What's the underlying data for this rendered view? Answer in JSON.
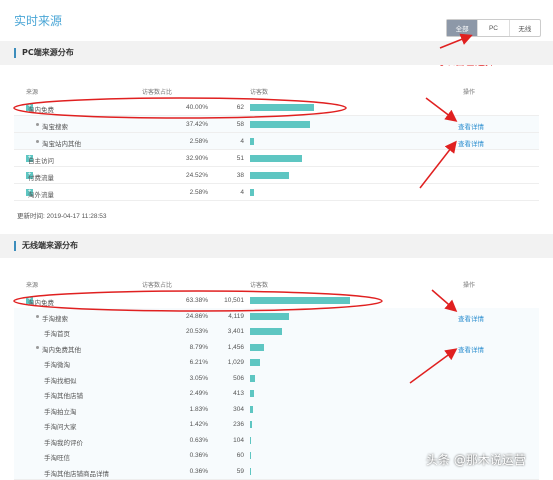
{
  "header": {
    "title": "实时来源"
  },
  "segment": {
    "options": [
      "全部",
      "PC",
      "无线"
    ],
    "selected": "全部"
  },
  "annotation": {
    "note": "可以自己选择!"
  },
  "pc": {
    "title": "PC端来源分布",
    "columns": {
      "source": "来源",
      "share": "访客数占比",
      "visitors": "访客数",
      "action": "操作"
    },
    "rows": [
      {
        "name": "淘内免费",
        "share": "40.00%",
        "count": "62",
        "bar": 1.0,
        "expand": true,
        "op": ""
      },
      {
        "name": "淘宝搜索",
        "share": "37.42%",
        "count": "58",
        "bar": 0.935,
        "sub": true,
        "op": "查看详情"
      },
      {
        "name": "淘宝站内其他",
        "share": "2.58%",
        "count": "4",
        "bar": 0.065,
        "sub": true,
        "op": "查看详情"
      },
      {
        "name": "自主访问",
        "share": "32.90%",
        "count": "51",
        "bar": 0.82,
        "expand": true,
        "op": ""
      },
      {
        "name": "付费流量",
        "share": "24.52%",
        "count": "38",
        "bar": 0.61,
        "expand": true,
        "op": ""
      },
      {
        "name": "淘外流量",
        "share": "2.58%",
        "count": "4",
        "bar": 0.065,
        "expand": true,
        "op": ""
      }
    ],
    "updated": "更新时间: 2019-04-17 11:28:53"
  },
  "mobile": {
    "title": "无线端来源分布",
    "columns": {
      "source": "来源",
      "share": "访客数占比",
      "visitors": "访客数",
      "action": "操作"
    },
    "rows": [
      {
        "name": "淘内免费",
        "share": "63.38%",
        "count": "10,501",
        "bar": 1.0,
        "expand": true,
        "op": ""
      },
      {
        "name": "手淘搜索",
        "share": "24.86%",
        "count": "4,119",
        "bar": 0.392,
        "sub": true,
        "op": "查看详情"
      },
      {
        "name": "手淘首页",
        "share": "20.53%",
        "count": "3,401",
        "bar": 0.324,
        "sub2": true,
        "op": ""
      },
      {
        "name": "淘内免费其他",
        "share": "8.79%",
        "count": "1,456",
        "bar": 0.139,
        "sub": true,
        "op": "查看详情"
      },
      {
        "name": "手淘微淘",
        "share": "6.21%",
        "count": "1,029",
        "bar": 0.098,
        "sub2": true,
        "op": ""
      },
      {
        "name": "手淘找相似",
        "share": "3.05%",
        "count": "506",
        "bar": 0.048,
        "sub2": true,
        "op": ""
      },
      {
        "name": "手淘其他店铺",
        "share": "2.49%",
        "count": "413",
        "bar": 0.039,
        "sub2": true,
        "op": ""
      },
      {
        "name": "手淘拍立淘",
        "share": "1.83%",
        "count": "304",
        "bar": 0.029,
        "sub2": true,
        "op": ""
      },
      {
        "name": "手淘问大家",
        "share": "1.42%",
        "count": "236",
        "bar": 0.022,
        "sub2": true,
        "op": ""
      },
      {
        "name": "手淘我的评价",
        "share": "0.63%",
        "count": "104",
        "bar": 0.01,
        "sub2": true,
        "op": ""
      },
      {
        "name": "手淘旺信",
        "share": "0.36%",
        "count": "60",
        "bar": 0.006,
        "sub2": true,
        "op": ""
      },
      {
        "name": "手淘其他店铺商品详情",
        "share": "0.36%",
        "count": "59",
        "bar": 0.006,
        "sub2": true,
        "op": ""
      }
    ]
  },
  "watermark": "头条 @那木说运营",
  "colors": {
    "accent": "#4aa6d6",
    "bar": "#5ec6c2",
    "link": "#2d8fd0",
    "annotation": "#e02020"
  }
}
